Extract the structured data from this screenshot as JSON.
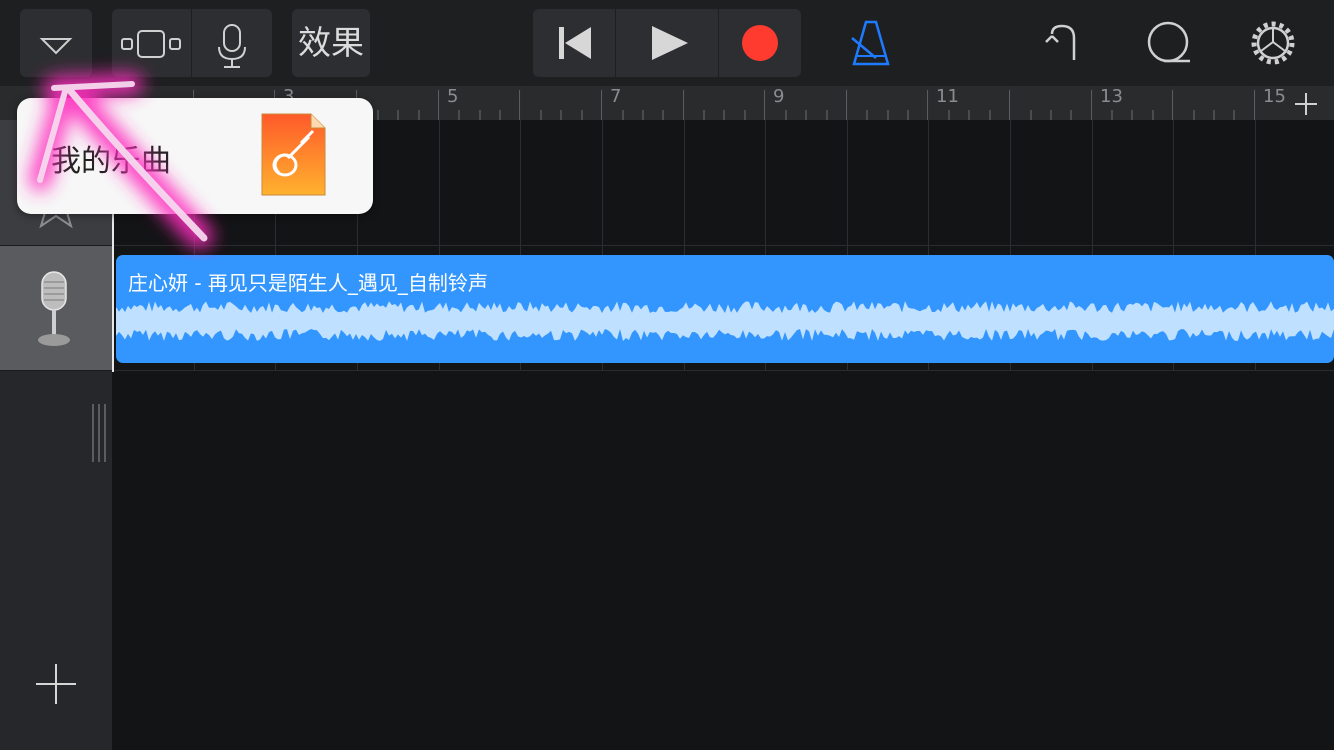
{
  "toolbar": {
    "effects_label": "效果",
    "icons": [
      "dropdown-triangle-icon",
      "tracks-view-icon",
      "microphone-icon",
      "go-to-start-icon",
      "play-icon",
      "record-icon",
      "metronome-icon",
      "undo-icon",
      "loop-icon",
      "settings-gear-icon"
    ],
    "colors": {
      "record": "#ff3b30",
      "metronome": "#1e7bff"
    }
  },
  "ruler": {
    "bar_numbers": [
      "3",
      "5",
      "7",
      "9",
      "11",
      "13",
      "15"
    ],
    "add_section_icon": "plus-icon"
  },
  "popup": {
    "label": "我的乐曲",
    "icon": "garageband-file-icon"
  },
  "tracks": [
    {
      "instrument_icon": "drum-star-icon"
    },
    {
      "instrument_icon": "vintage-microphone-icon",
      "region_title": "庄心妍 - 再见只是陌生人_遇见_自制铃声",
      "region_color": "#3396ff"
    }
  ],
  "sidebar": {
    "add_track_icon": "plus-icon",
    "resize_handle_icon": "drag-handle-icon"
  },
  "annotation": {
    "color": "#ff2fbf",
    "shape": "hand-drawn-arrow"
  }
}
